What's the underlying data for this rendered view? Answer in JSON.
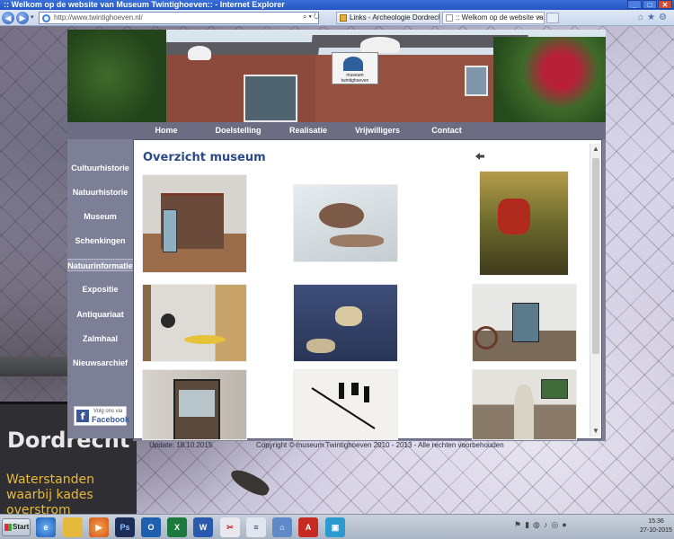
{
  "window": {
    "title": ":: Welkom op de website van Museum Twintighoeven:: - Internet Explorer"
  },
  "browser": {
    "address": "http://www.twintighoeven.nl/",
    "tabs": [
      {
        "label": "Links - Archeologie Dordrecht"
      },
      {
        "label": ":: Welkom op de website va..."
      }
    ]
  },
  "site": {
    "menu": [
      "Home",
      "Doelstelling",
      "Realisatie",
      "Vrijwilligers",
      "Contact"
    ],
    "sidebar": [
      "Cultuurhistorie",
      "Natuurhistorie",
      "Museum",
      "Schenkingen",
      "Natuurinformatie",
      "Expositie",
      "Antiquariaat",
      "Zalmhaal",
      "Nieuwsarchief"
    ],
    "sidebar_selected": 4,
    "facebook": {
      "line1": "Volg ons via",
      "line2": "Facebook"
    },
    "page_title": "Overzicht museum",
    "footer": {
      "update": "Update: 18.10.2015",
      "copyright": "Copyright © museum Twintighoeven 2010 - 2013 - Alle rechten voorbehouden"
    },
    "header_sign": "museum twintighoeven"
  },
  "wallpaper": {
    "sign_title": "Dordrecht",
    "sign_sub": "Waterstanden\nwaarbij kades\noverstrom"
  },
  "taskbar": {
    "start_label": "Start",
    "icons": [
      "internet-explorer",
      "file-explorer",
      "media-player",
      "photoshop",
      "outlook",
      "excel",
      "word",
      "snipping-tool",
      "notepad",
      "network",
      "acrobat",
      "app"
    ],
    "time": "15:36",
    "date": "27-10-2015"
  },
  "colors": {
    "title_blue": "#2b4a87",
    "menu_bg": "#6c6d83",
    "sidebar_bg": "#7d7f97",
    "facebook_blue": "#3b5998"
  }
}
